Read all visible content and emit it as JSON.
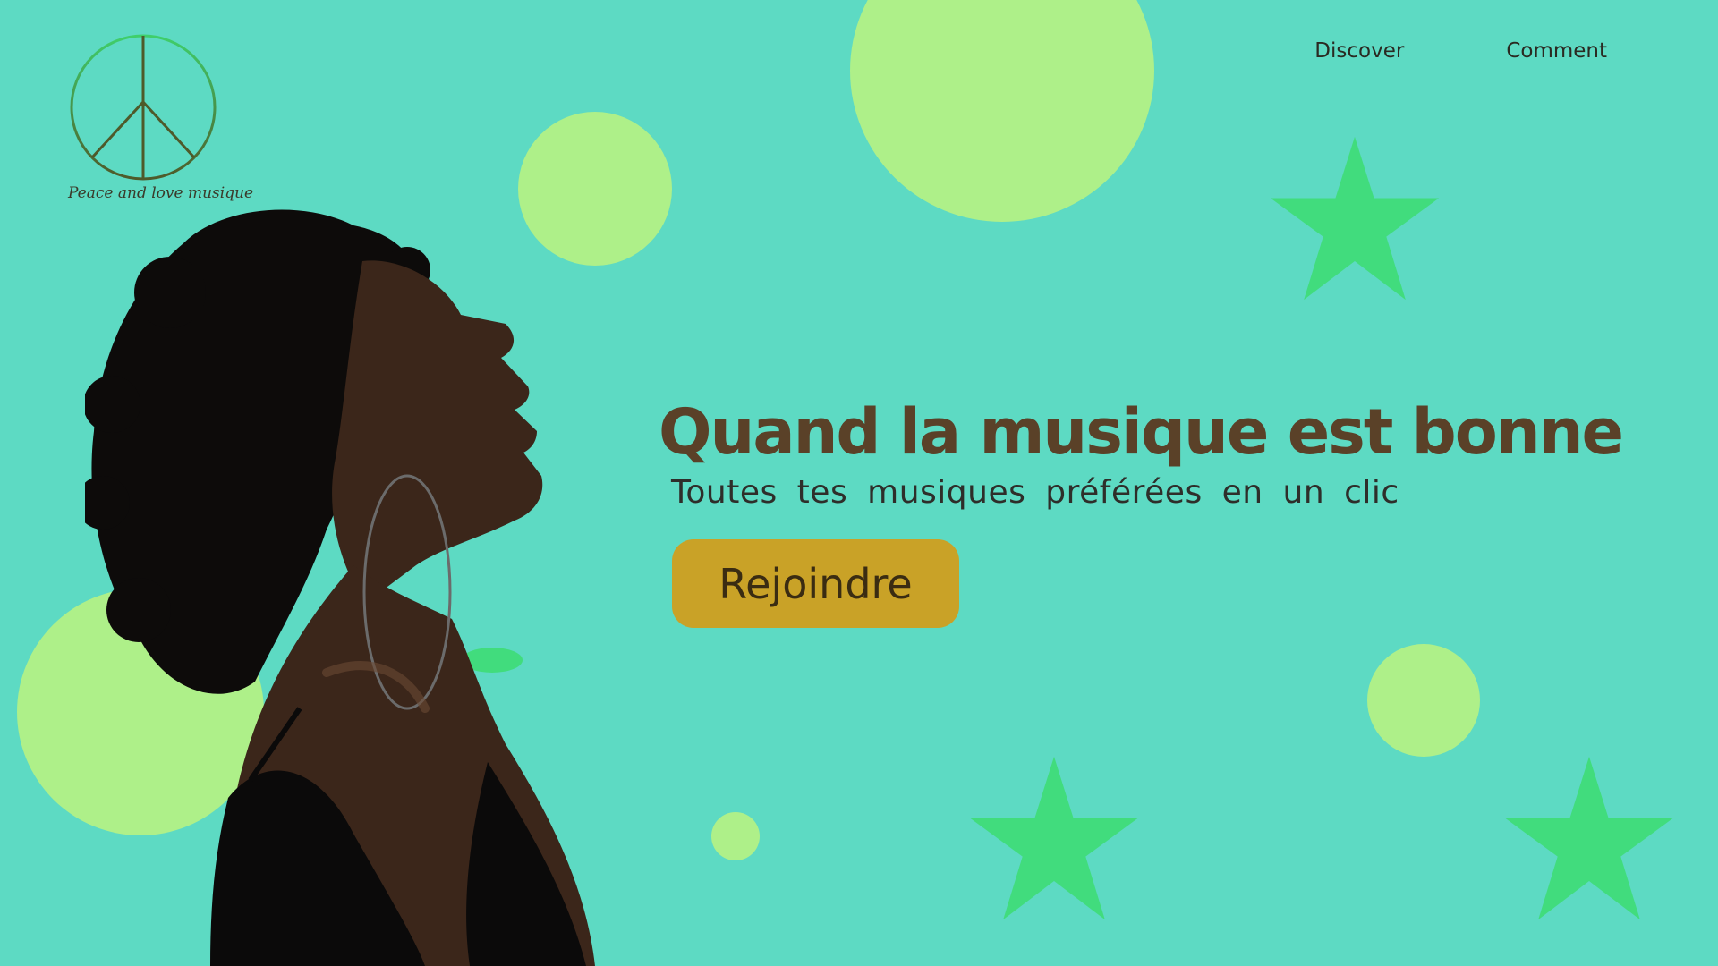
{
  "colors": {
    "background": "#5ddac3",
    "circle": "#aef089",
    "star": "#41dc7d",
    "title": "#5a4128",
    "button": "#c9a227",
    "logo_ring": "#3fcf6b"
  },
  "logo": {
    "icon": "peace-sign-icon",
    "text": "Peace and love musique"
  },
  "nav": {
    "items": [
      {
        "label": "Discover"
      },
      {
        "label": "Comment"
      }
    ]
  },
  "hero": {
    "title": "Quand la musique est bonne",
    "subtitle": "Toutes tes musiques préférées en un clic",
    "cta_label": "Rejoindre"
  },
  "photo": {
    "subject": "woman-profile-photo"
  }
}
